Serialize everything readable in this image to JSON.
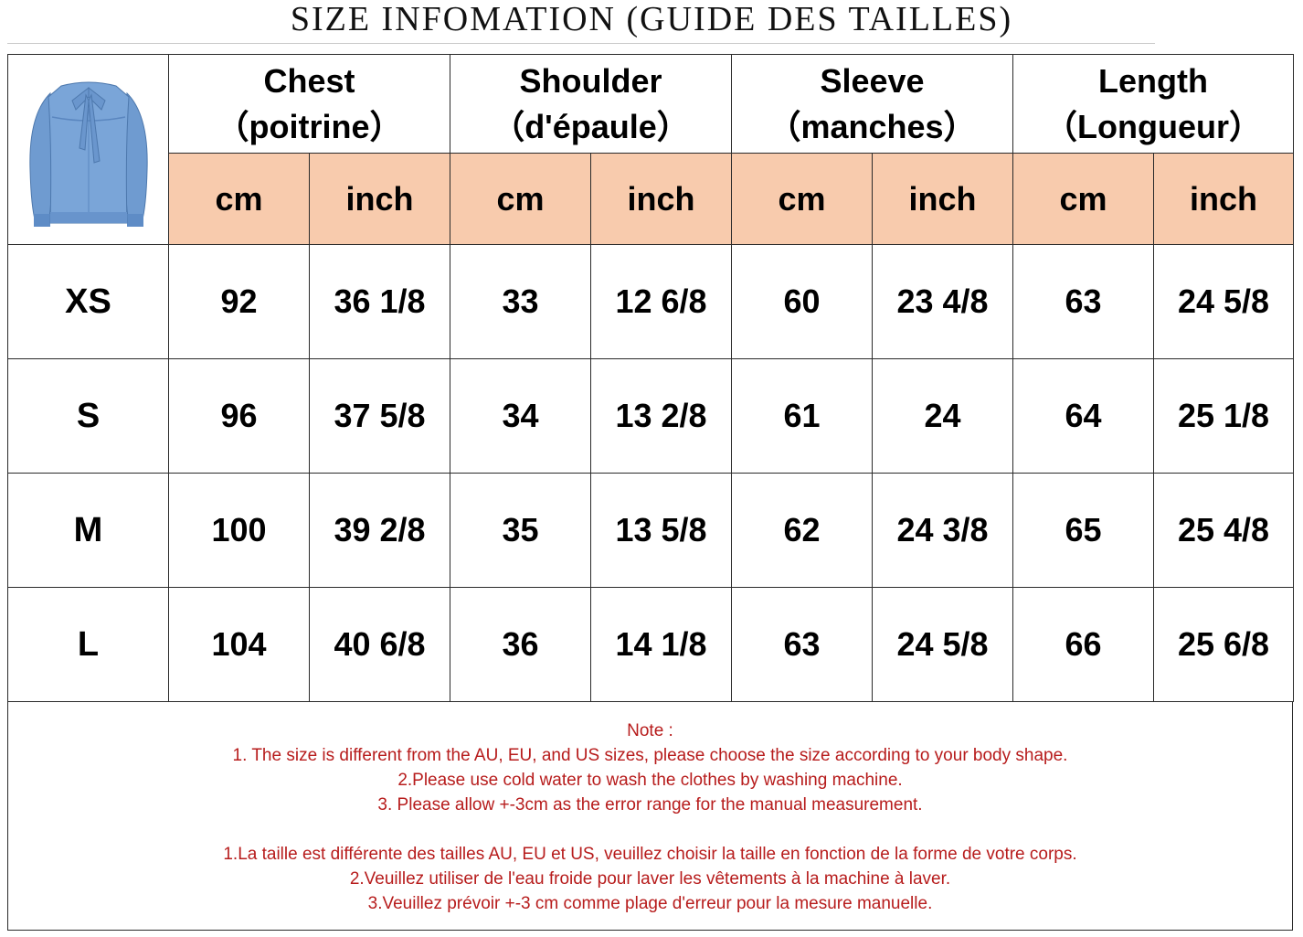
{
  "title": "SIZE INFOMATION (GUIDE DES TAILLES)",
  "product_image": "denim-blouse-with-bow-image",
  "headers": [
    {
      "en": "Chest",
      "fr": "（poitrine）"
    },
    {
      "en": "Shoulder",
      "fr": "（d'épaule）"
    },
    {
      "en": "Sleeve",
      "fr": "（manches）"
    },
    {
      "en": "Length",
      "fr": "（Longueur）"
    }
  ],
  "units": [
    "cm",
    "inch",
    "cm",
    "inch",
    "cm",
    "inch",
    "cm",
    "inch"
  ],
  "rows": [
    {
      "size": "XS",
      "values": [
        "92",
        "36 1/8",
        "33",
        "12 6/8",
        "60",
        "23 4/8",
        "63",
        "24 5/8"
      ]
    },
    {
      "size": "S",
      "values": [
        "96",
        "37 5/8",
        "34",
        "13 2/8",
        "61",
        "24",
        "64",
        "25 1/8"
      ]
    },
    {
      "size": "M",
      "values": [
        "100",
        "39 2/8",
        "35",
        "13 5/8",
        "62",
        "24 3/8",
        "65",
        "25 4/8"
      ]
    },
    {
      "size": "L",
      "values": [
        "104",
        "40 6/8",
        "36",
        "14 1/8",
        "63",
        "24 5/8",
        "66",
        "25 6/8"
      ]
    }
  ],
  "notes": {
    "heading": "Note :",
    "en": [
      "1. The size is different from the AU, EU, and US sizes, please choose the size according to your body shape.",
      "2.Please use cold water to wash the clothes by washing machine.",
      "3. Please allow +-3cm as the error range for the manual measurement."
    ],
    "fr": [
      "1.La taille est différente des tailles AU, EU et US, veuillez choisir la taille en fonction de la forme de votre corps.",
      "2.Veuillez utiliser de l'eau froide pour laver les vêtements à la machine à laver.",
      "3.Veuillez prévoir +-3 cm comme plage d'erreur pour la mesure manuelle."
    ]
  },
  "colors": {
    "unit_row_bg": "#f8cbad",
    "note_text": "#b71c1c",
    "border": "#2a2a2a"
  }
}
